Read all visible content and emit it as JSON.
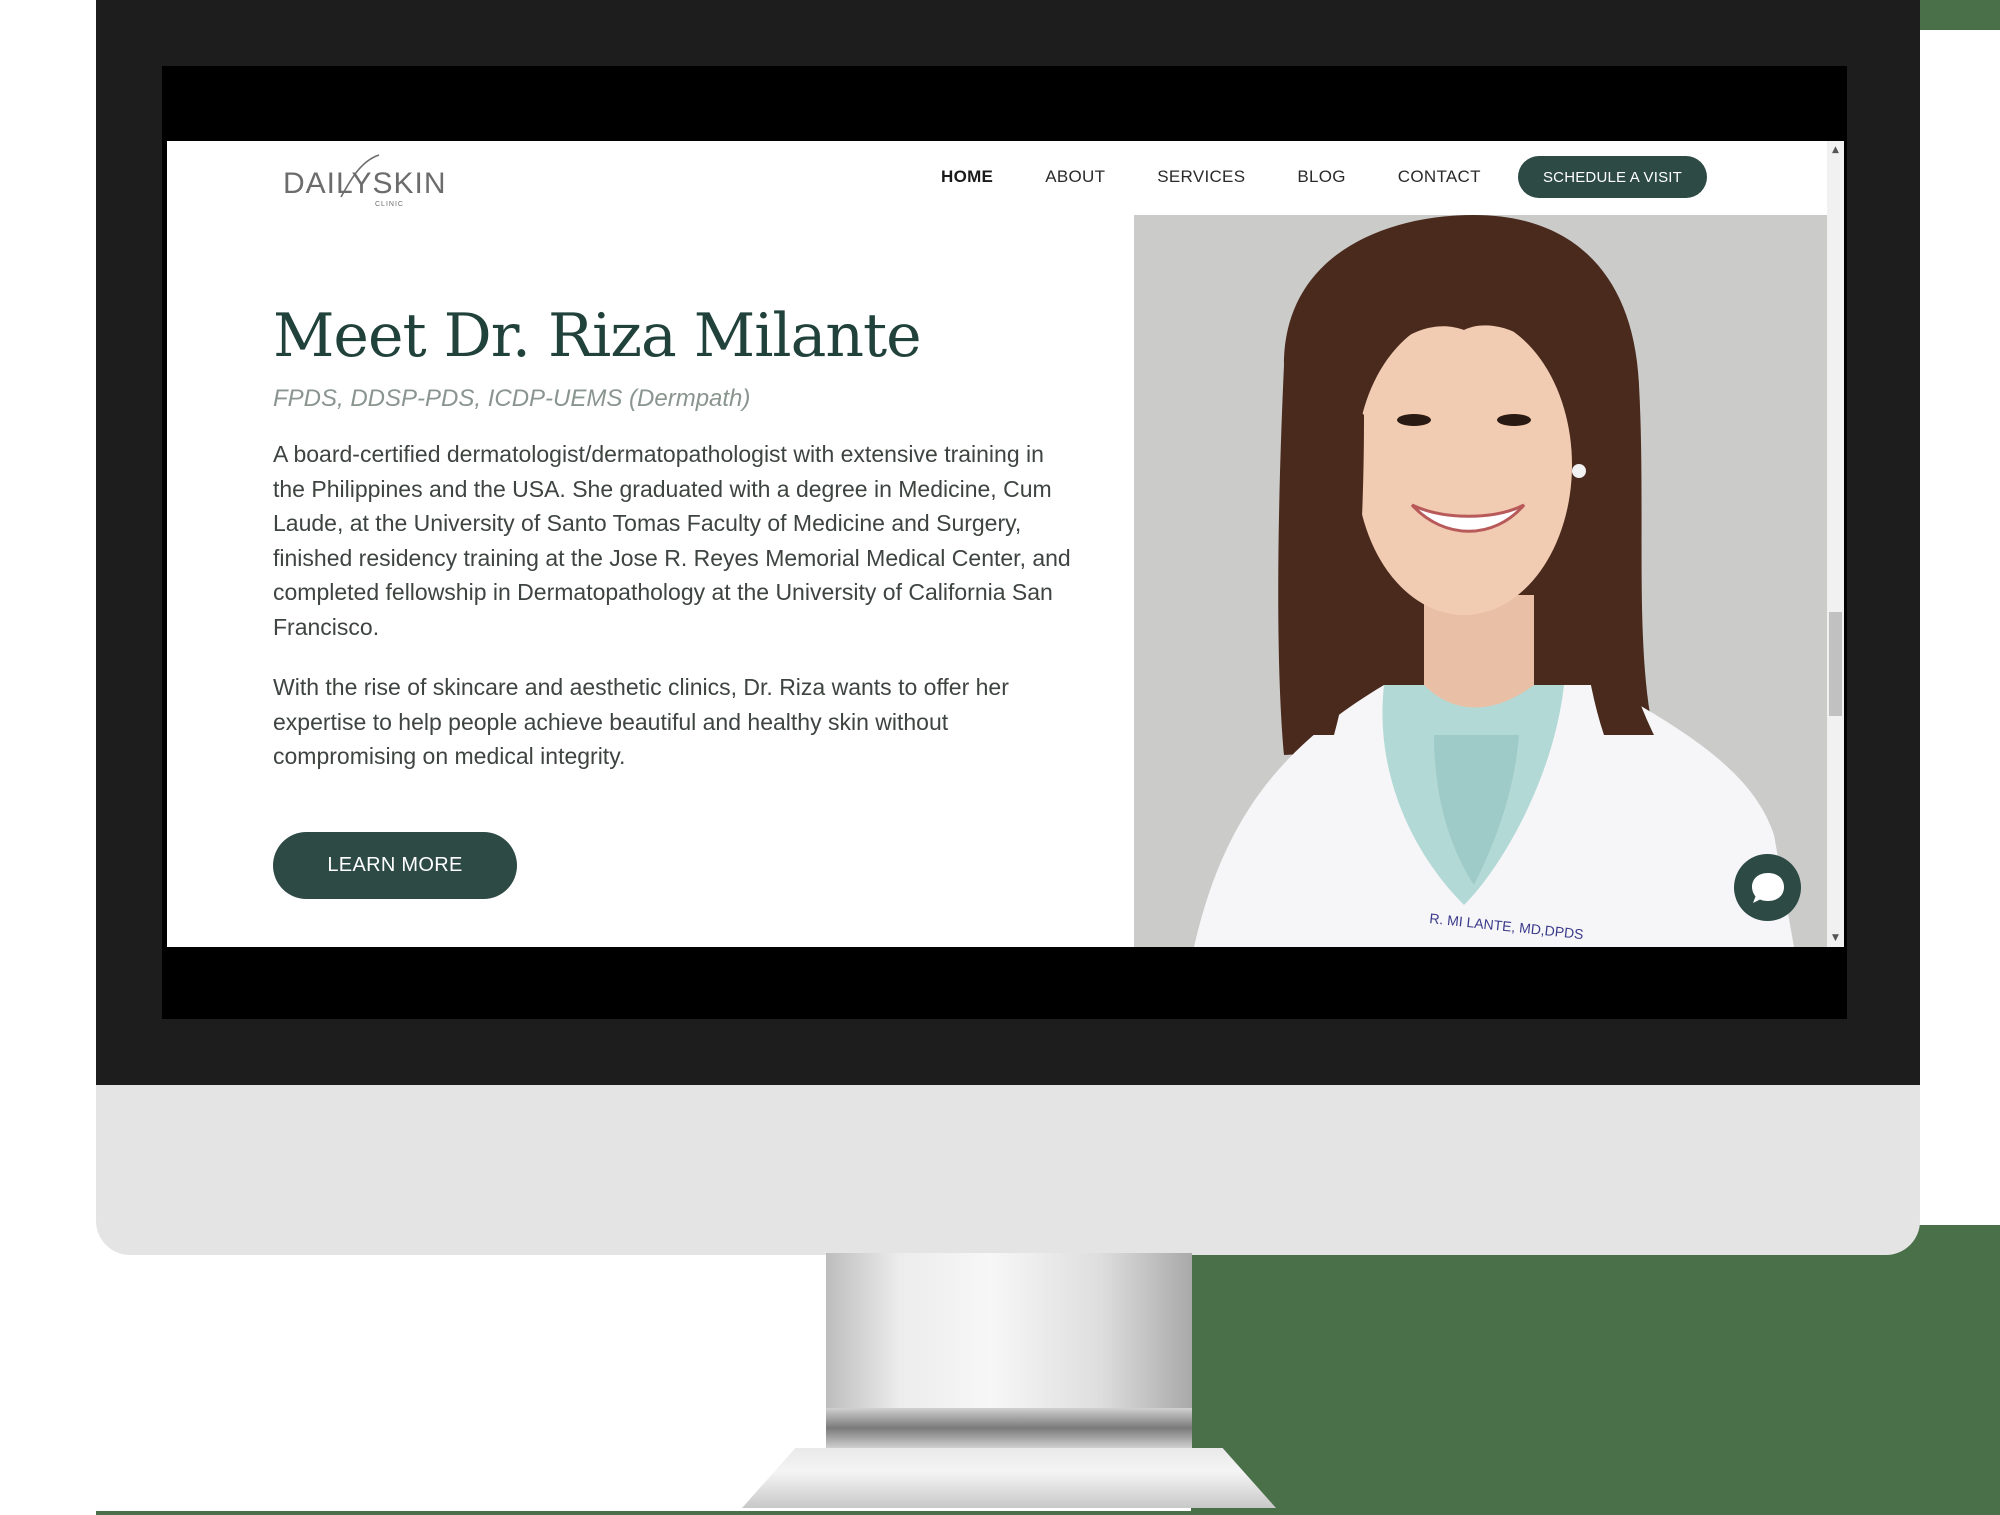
{
  "site": {
    "logo_text": "DAILYSKIN",
    "logo_subtext": "CLINIC"
  },
  "nav": {
    "items": [
      {
        "label": "HOME",
        "active": true
      },
      {
        "label": "ABOUT",
        "active": false
      },
      {
        "label": "SERVICES",
        "active": false
      },
      {
        "label": "BLOG",
        "active": false
      },
      {
        "label": "CONTACT",
        "active": false
      }
    ],
    "cta_label": "SCHEDULE A VISIT"
  },
  "hero": {
    "title": "Meet Dr. Riza Milante",
    "credentials": "FPDS, DDSP-PDS, ICDP-UEMS (Dermpath)",
    "paragraph_1": "A board-certified dermatologist/dermatopathologist with extensive training in the Philippines and the USA. She graduated with a degree in Medicine, Cum Laude, at the University of Santo Tomas Faculty of Medicine and Surgery, finished residency training at the Jose R. Reyes Memorial Medical Center, and completed fellowship in Dermatopathology at the University of California San Francisco.",
    "paragraph_2": "With the rise of skincare and aesthetic clinics, Dr. Riza wants to offer her expertise to help people achieve beautiful and healthy skin without compromising on medical integrity.",
    "button_label": "LEARN MORE",
    "coat_embroidery": "R. MI LANTE, MD,DPDS"
  },
  "icons": {
    "chat": "chat-bubble-icon",
    "scroll_up": "chevron-up-icon",
    "scroll_down": "chevron-down-icon"
  },
  "colors": {
    "brand_dark_green": "#2d4a45",
    "title_green": "#21413b",
    "credential_gray": "#8a958f",
    "photo_background": "#cbcbc9",
    "scrubs_blue": "#b3d9d6"
  }
}
